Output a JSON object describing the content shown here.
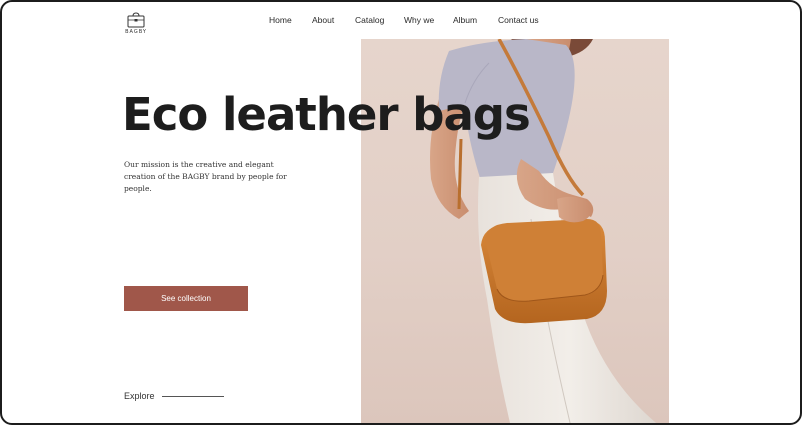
{
  "brand": {
    "logo_text": "BAGBY"
  },
  "nav": {
    "items": [
      {
        "label": "Home"
      },
      {
        "label": "About"
      },
      {
        "label": "Catalog"
      },
      {
        "label": "Why we"
      },
      {
        "label": "Album"
      },
      {
        "label": "Contact us"
      }
    ]
  },
  "hero": {
    "title": "Eco leather bags",
    "mission": "Our mission is the creative and elegant creation of the BAGBY brand by people for people.",
    "cta_label": "See collection",
    "explore_label": "Explore"
  },
  "colors": {
    "accent": "#a0574a",
    "photo_background": "#e4d2c9",
    "bag_leather": "#c8772e"
  }
}
